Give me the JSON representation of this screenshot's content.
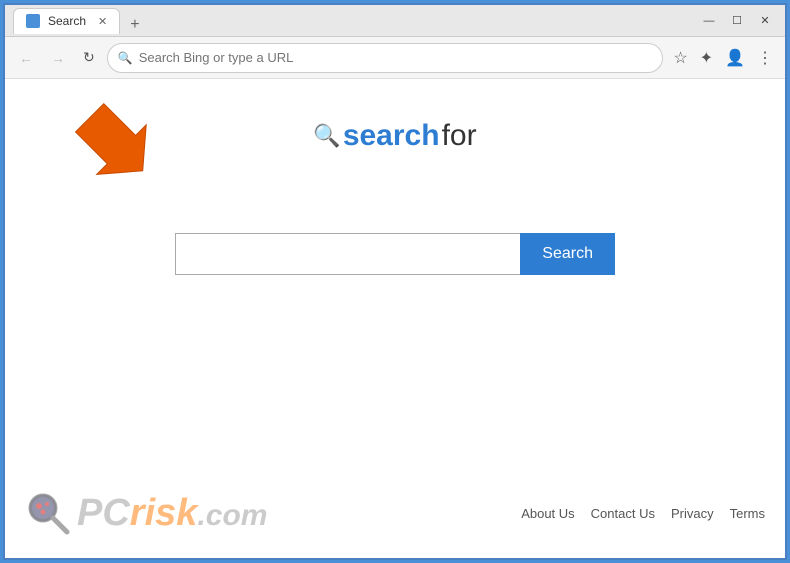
{
  "browser": {
    "tab_title": "Search",
    "new_tab_label": "+",
    "address_placeholder": "Search Bing or type a URL",
    "address_value": "",
    "window_controls": {
      "minimize": "—",
      "maximize": "☐",
      "close": "✕"
    }
  },
  "nav": {
    "back_label": "←",
    "forward_label": "→",
    "refresh_label": "↻"
  },
  "toolbar": {
    "favorites_icon": "☆",
    "extensions_icon": "✦",
    "profile_icon": "👤",
    "menu_icon": "⋮"
  },
  "logo": {
    "icon": "🔍",
    "text_search": "search",
    "text_for": "for"
  },
  "search": {
    "input_placeholder": "",
    "button_label": "Search"
  },
  "footer": {
    "links": [
      {
        "label": "About Us",
        "id": "about-us"
      },
      {
        "label": "Contact Us",
        "id": "contact-us"
      },
      {
        "label": "Privacy",
        "id": "privacy"
      },
      {
        "label": "Terms",
        "id": "terms"
      }
    ]
  },
  "pcrisk": {
    "pc": "PC",
    "risk": "risk",
    "dotcom": ".com"
  },
  "colors": {
    "accent_blue": "#2d7dd2",
    "orange": "#f70000",
    "browser_border": "#4a90d9"
  }
}
